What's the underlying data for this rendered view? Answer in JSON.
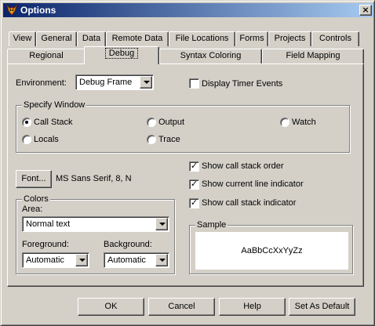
{
  "window": {
    "title": "Options",
    "close_glyph": "×",
    "app_icon": "fox-app-icon"
  },
  "tabs_row1": [
    {
      "label": "View"
    },
    {
      "label": "General"
    },
    {
      "label": "Data"
    },
    {
      "label": "Remote Data"
    },
    {
      "label": "File Locations"
    },
    {
      "label": "Forms"
    },
    {
      "label": "Projects"
    },
    {
      "label": "Controls"
    }
  ],
  "tabs_row2": [
    {
      "label": "Regional"
    },
    {
      "label": "Debug",
      "active": true
    },
    {
      "label": "Syntax Coloring"
    },
    {
      "label": "Field Mapping"
    }
  ],
  "environment": {
    "label": "Environment:",
    "value": "Debug Frame"
  },
  "display_timer": {
    "label": "Display Timer Events",
    "checked": false
  },
  "specify_window": {
    "caption": "Specify Window",
    "options": [
      {
        "label": "Call Stack",
        "selected": true
      },
      {
        "label": "Output",
        "selected": false
      },
      {
        "label": "Watch",
        "selected": false
      },
      {
        "label": "Locals",
        "selected": false
      },
      {
        "label": "Trace",
        "selected": false
      }
    ]
  },
  "font": {
    "button_label": "Font...",
    "value": "MS Sans Serif, 8, N"
  },
  "options": [
    {
      "label": "Show call stack order",
      "checked": true
    },
    {
      "label": "Show current line indicator",
      "checked": true
    },
    {
      "label": "Show call stack indicator",
      "checked": true
    }
  ],
  "colors": {
    "caption": "Colors",
    "area_label": "Area:",
    "area_value": "Normal text",
    "foreground_label": "Foreground:",
    "foreground_value": "Automatic",
    "background_label": "Background:",
    "background_value": "Automatic"
  },
  "sample": {
    "caption": "Sample",
    "text": "AaBbCcXxYyZz"
  },
  "buttons": {
    "ok": "OK",
    "cancel": "Cancel",
    "help": "Help",
    "set_default": "Set As Default"
  },
  "check_glyph": "✓"
}
